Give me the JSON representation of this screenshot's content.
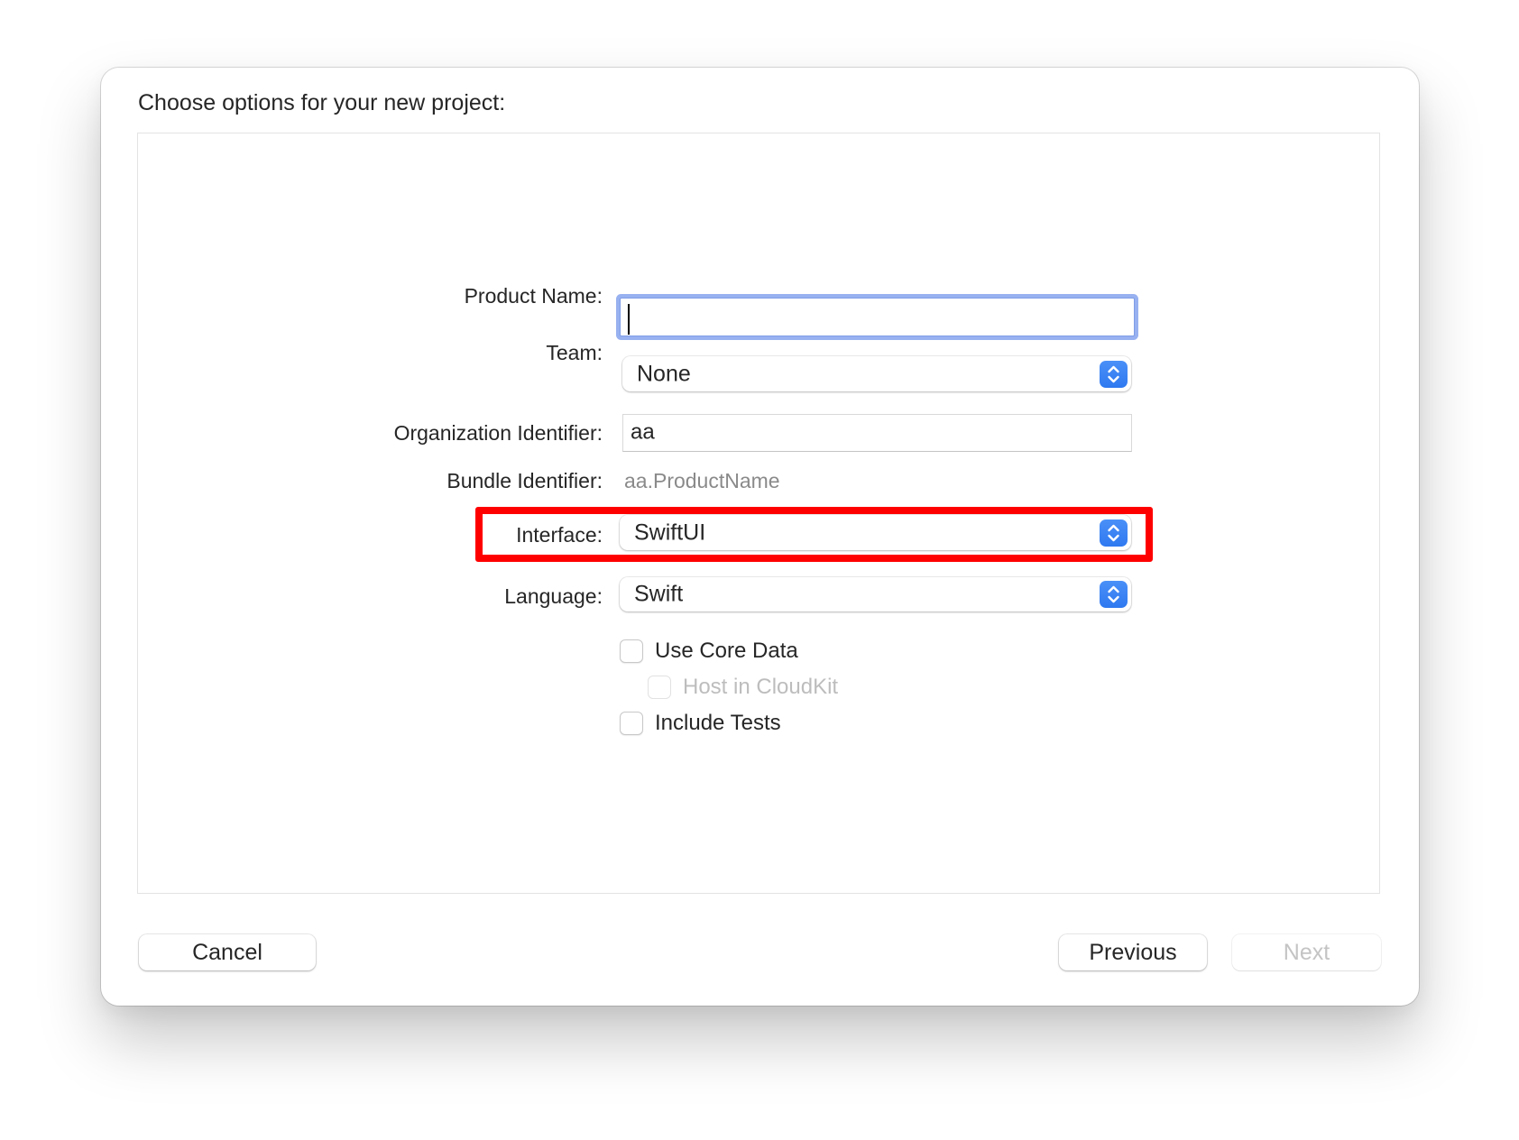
{
  "dialog": {
    "title": "Choose options for your new project:"
  },
  "form": {
    "product_name": {
      "label": "Product Name:",
      "value": "",
      "focused": true
    },
    "team": {
      "label": "Team:",
      "selected": "None"
    },
    "organization_identifier": {
      "label": "Organization Identifier:",
      "value": "aa"
    },
    "bundle_identifier": {
      "label": "Bundle Identifier:",
      "value": "aa.ProductName"
    },
    "interface": {
      "label": "Interface:",
      "selected": "SwiftUI",
      "highlighted": true
    },
    "language": {
      "label": "Language:",
      "selected": "Swift"
    },
    "checkboxes": [
      {
        "label": "Use Core Data",
        "checked": false,
        "enabled": true
      },
      {
        "label": "Host in CloudKit",
        "checked": false,
        "enabled": false
      },
      {
        "label": "Include Tests",
        "checked": false,
        "enabled": true
      }
    ]
  },
  "buttons": {
    "cancel": "Cancel",
    "previous": "Previous",
    "next": "Next",
    "next_enabled": false
  },
  "icons": {
    "popup_stepper": "up-down-chevron-icon"
  },
  "colors": {
    "accent": "#3b82f6",
    "focus_ring": "#98b1f0",
    "highlight_box": "#ff0000",
    "disabled_text": "#bdbdbd",
    "secondary_text": "#8a8a8a"
  }
}
